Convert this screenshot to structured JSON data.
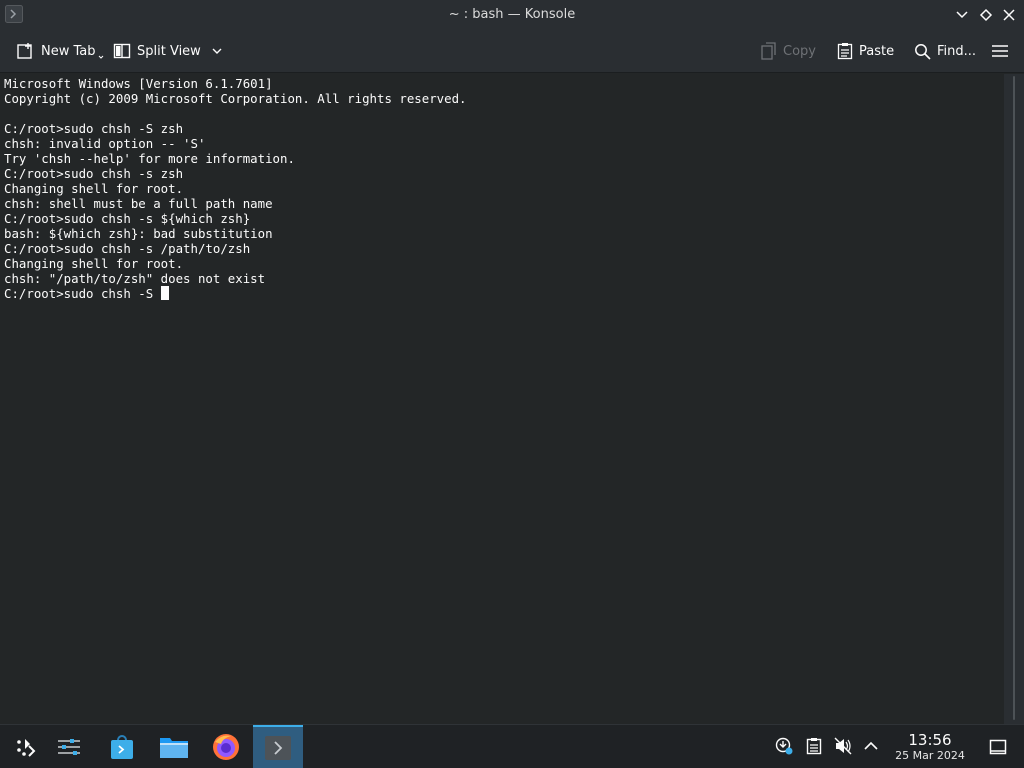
{
  "window": {
    "title": "~ : bash — Konsole"
  },
  "toolbar": {
    "new_tab": "New Tab",
    "split_view": "Split View",
    "copy": "Copy",
    "paste": "Paste",
    "find": "Find..."
  },
  "terminal": {
    "lines": [
      "Microsoft Windows [Version 6.1.7601]",
      "Copyright (c) 2009 Microsoft Corporation. All rights reserved.",
      "",
      "C:/root>sudo chsh -S zsh",
      "chsh: invalid option -- 'S'",
      "Try 'chsh --help' for more information.",
      "C:/root>sudo chsh -s zsh",
      "Changing shell for root.",
      "chsh: shell must be a full path name",
      "C:/root>sudo chsh -s ${which zsh}",
      "bash: ${which zsh}: bad substitution",
      "C:/root>sudo chsh -s /path/to/zsh",
      "Changing shell for root.",
      "chsh: \"/path/to/zsh\" does not exist"
    ],
    "prompt_line": "C:/root>sudo chsh -S "
  },
  "taskbar": {
    "time": "13:56",
    "date": "25 Mar 2024"
  },
  "colors": {
    "background": "#232627",
    "chrome": "#2a2e32",
    "text": "#fcfcfc",
    "accent": "#3daee9"
  },
  "icons": {
    "app": "konsole-icon",
    "minimize": "chevron-down-icon",
    "maximize": "diamond-icon",
    "close": "close-icon",
    "new_tab": "new-tab-icon",
    "split_view": "split-view-icon",
    "copy": "copy-icon",
    "paste": "paste-icon",
    "find": "search-icon",
    "menu": "hamburger-menu-icon"
  }
}
